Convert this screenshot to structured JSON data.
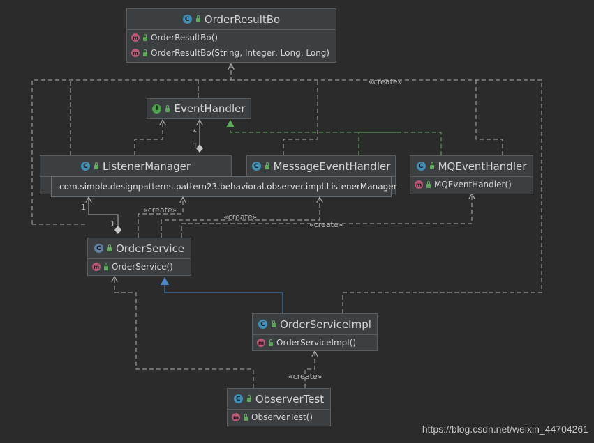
{
  "nodes": {
    "order_result_bo": {
      "name": "OrderResultBo",
      "kind": "class",
      "methods": [
        "OrderResultBo()",
        "OrderResultBo(String, Integer, Long, Long)"
      ]
    },
    "event_handler": {
      "name": "EventHandler",
      "kind": "interface",
      "methods": []
    },
    "listener_manager": {
      "name": "ListenerManager",
      "kind": "class",
      "methods": []
    },
    "message_event_handler": {
      "name": "MessageEventHandler",
      "kind": "class",
      "methods": []
    },
    "mq_event_handler": {
      "name": "MQEventHandler",
      "kind": "class",
      "methods": [
        "MQEventHandler()"
      ]
    },
    "order_service": {
      "name": "OrderService",
      "kind": "abstract-class",
      "methods": [
        "OrderService()"
      ]
    },
    "order_service_impl": {
      "name": "OrderServiceImpl",
      "kind": "class",
      "methods": [
        "OrderServiceImpl()"
      ]
    },
    "observer_test": {
      "name": "ObserverTest",
      "kind": "class",
      "methods": [
        "ObserverTest()"
      ]
    }
  },
  "icons": {
    "class": "C",
    "interface": "I",
    "method": "m",
    "abstract": "C"
  },
  "tooltip": "com.simple.designpatterns.pattern23.behavioral.observer.impl.ListenerManager",
  "labels": {
    "create": "«create»",
    "mult_star": "*",
    "mult_one": "1"
  },
  "colors": {
    "background": "#2b2b2b",
    "node_fill": "#3c3f41",
    "dependency_line": "#b0b0b0",
    "realization_line": "#5fa85c",
    "extends_line": "#4a88c7"
  },
  "watermark": "https://blog.csdn.net/weixin_44704261"
}
